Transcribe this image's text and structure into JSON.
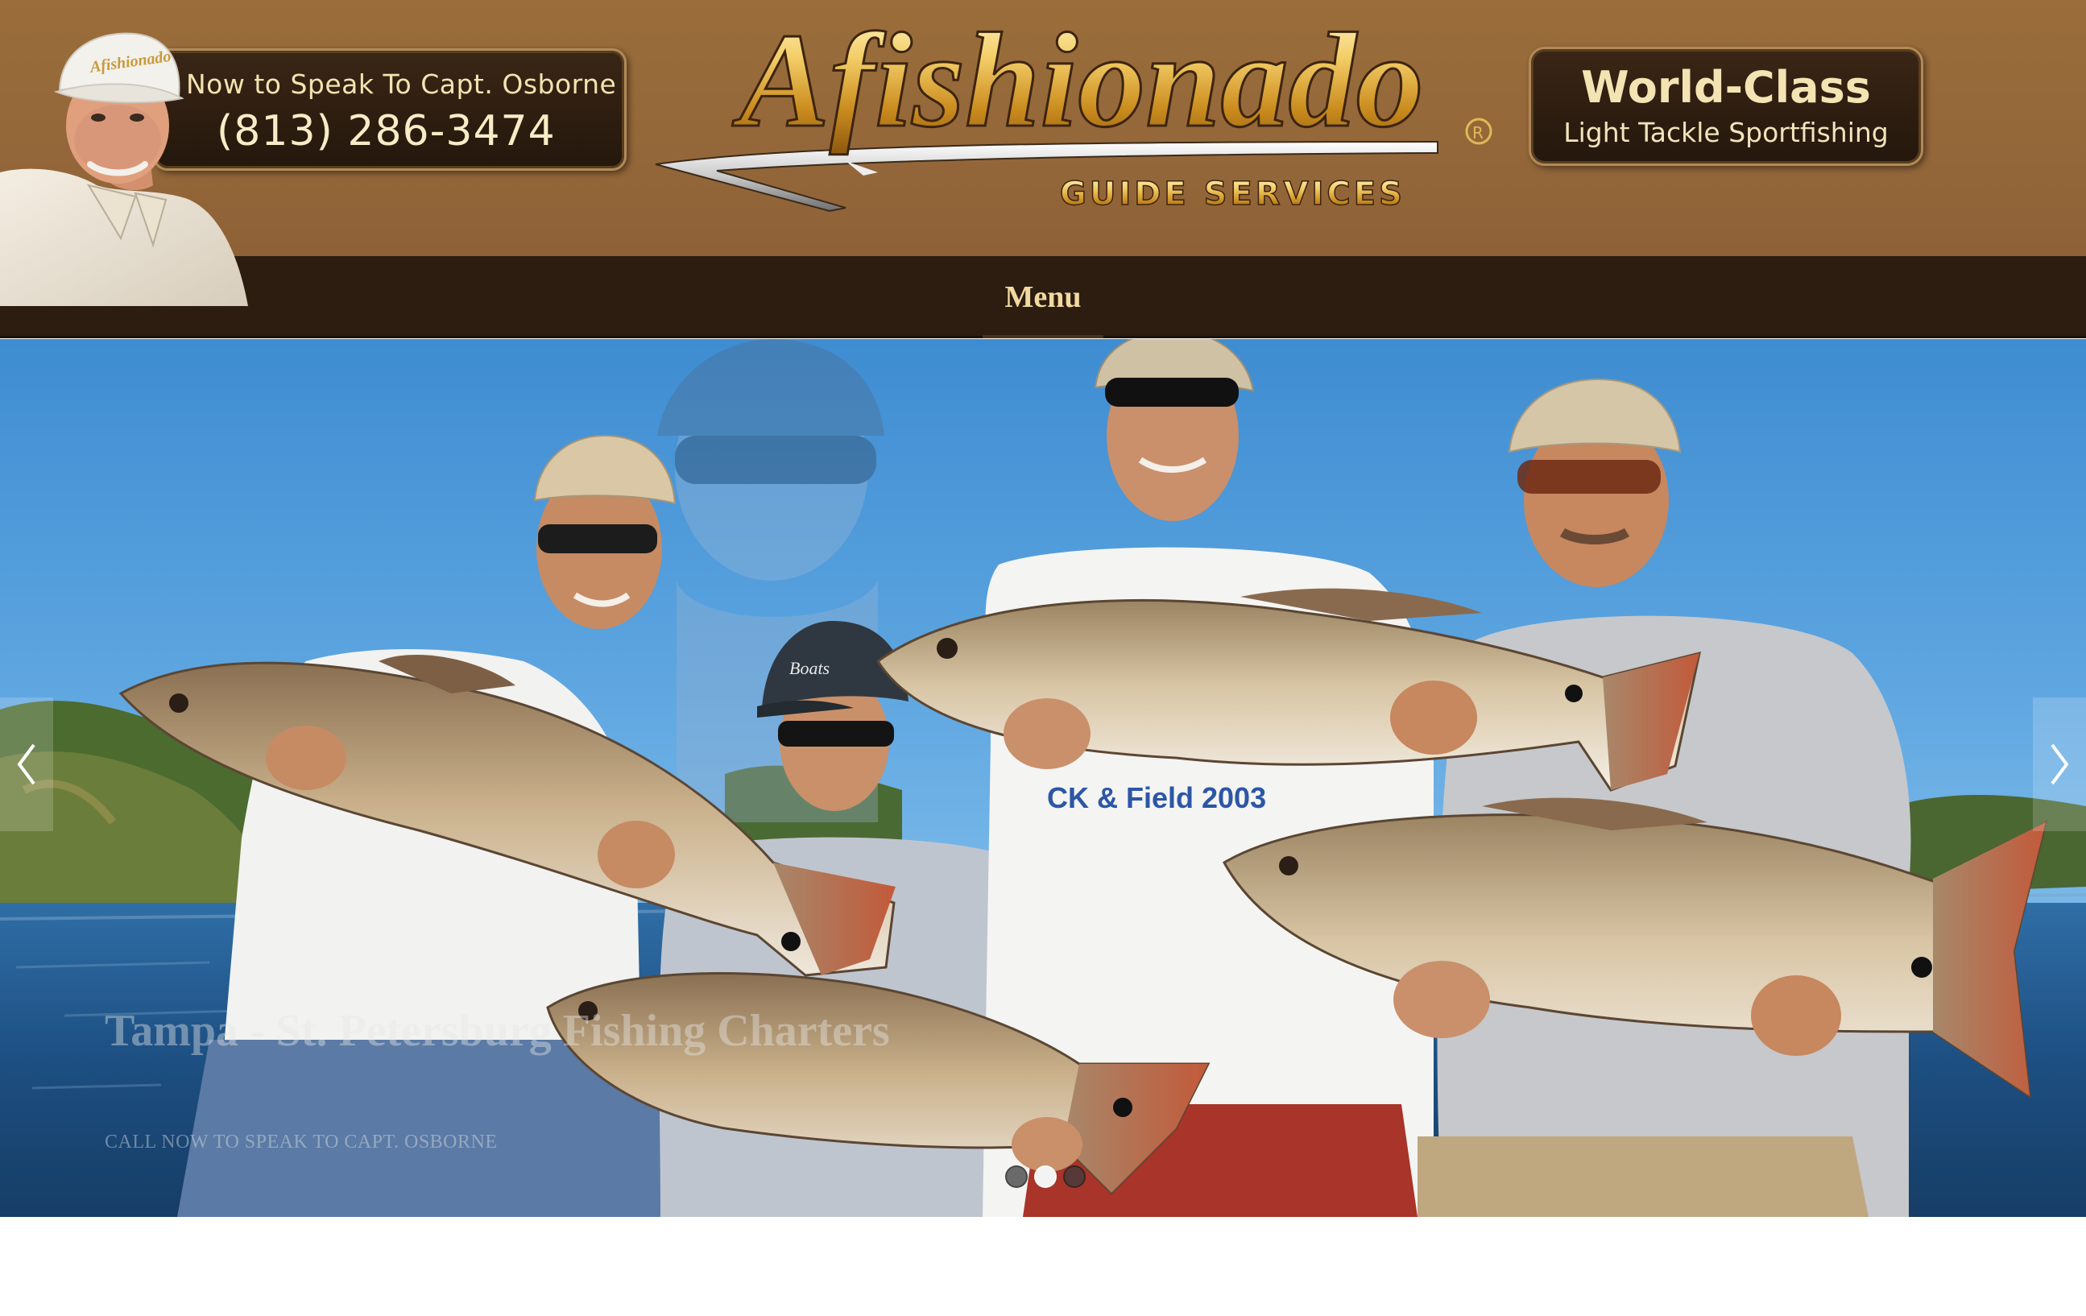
{
  "header": {
    "call_text": "Now to Speak To Capt. Osborne",
    "phone": "(813) 286-3474",
    "logo_title": "Afishionado",
    "logo_registered": "®",
    "logo_subtitle": "GUIDE SERVICES",
    "tagline_title": "World-Class",
    "tagline_subtitle": "Light Tackle Sportfishing",
    "cap_logo_text": "Afishionado"
  },
  "nav": {
    "menu_label": "Menu"
  },
  "slider": {
    "caption_title": "Tampa - St. Petersburg Fishing Charters",
    "caption_subtitle": "CALL NOW TO SPEAK TO CAPT. OSBORNE",
    "shirt_text": "CK & Field 2003",
    "slides_total": 3,
    "active_slide": 2,
    "prev_arrow_icon": "chevron-left-icon",
    "next_arrow_icon": "chevron-right-icon"
  },
  "colors": {
    "header_brown": "#96693a",
    "nav_dark": "#2c1d10",
    "menu_text": "#f1d9a0",
    "panel_dark": "#2a1b0e",
    "panel_text": "#f5e4b3"
  }
}
